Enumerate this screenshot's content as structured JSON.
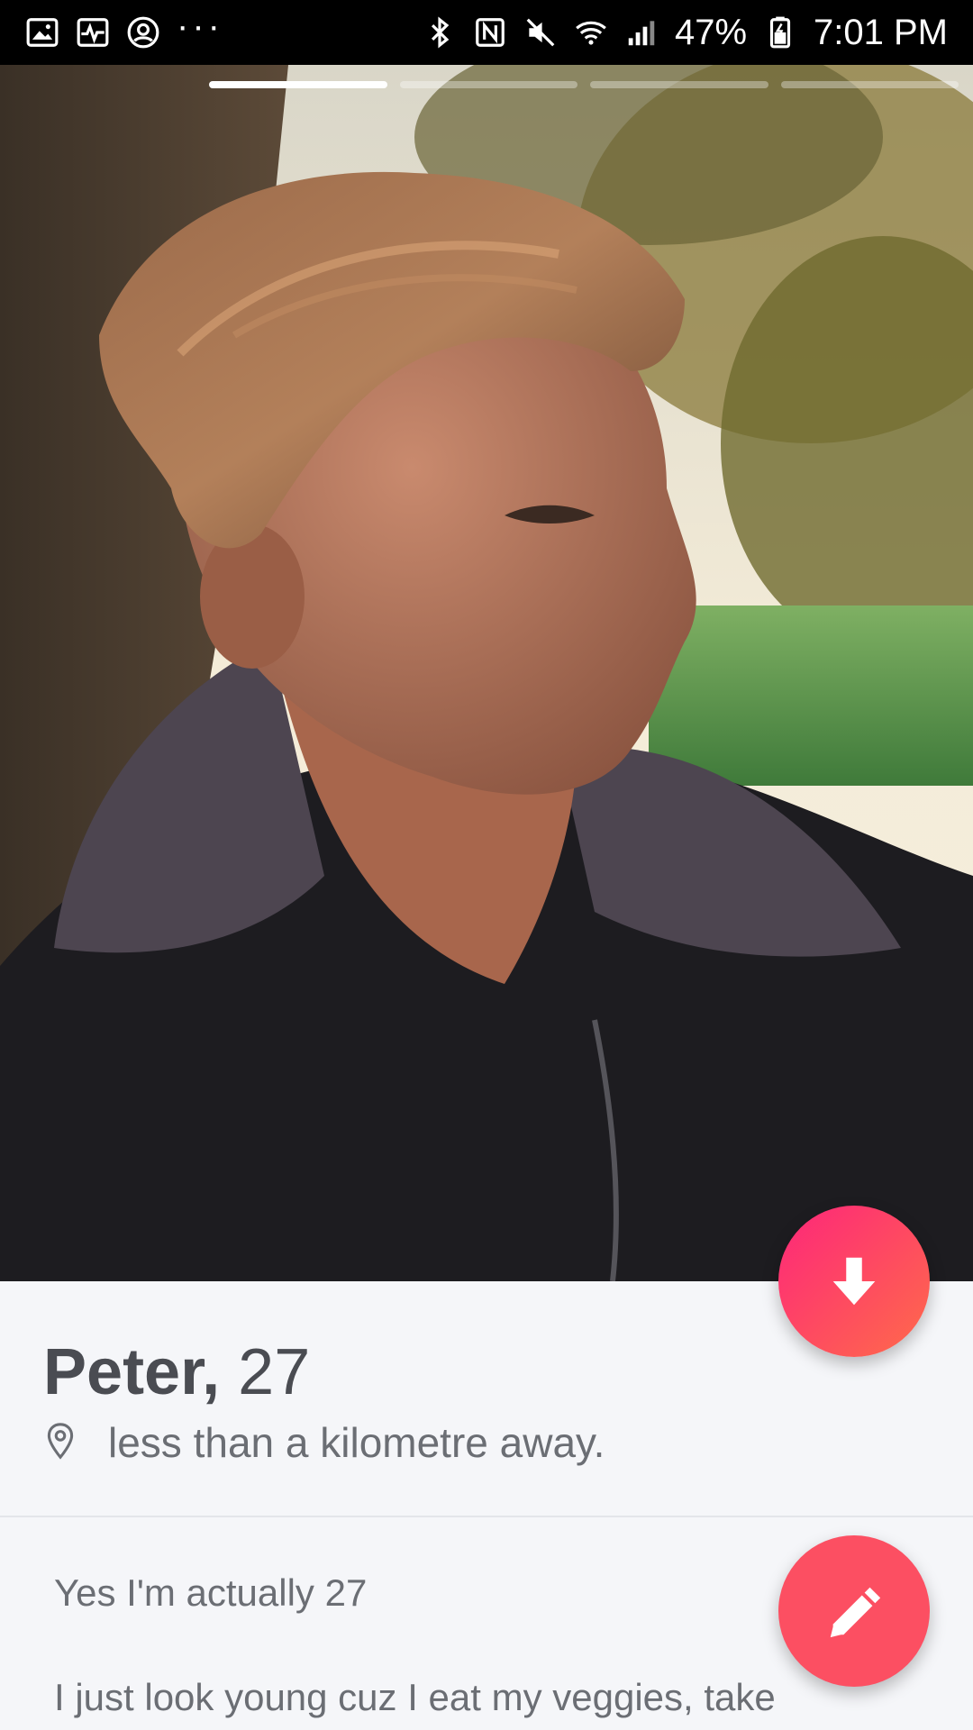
{
  "status_bar": {
    "left_icons": [
      "gallery-icon",
      "activity-icon",
      "account-icon",
      "more-dots-icon"
    ],
    "more_dots": "···",
    "right_icons": [
      "bluetooth-icon",
      "nfc-icon",
      "mute-icon",
      "wifi-icon",
      "signal-icon"
    ],
    "battery_percent": "47%",
    "time": "7:01 PM"
  },
  "photo": {
    "segments": 4,
    "active_segment": 1
  },
  "profile": {
    "name": "Peter,",
    "age": "27",
    "distance": "less than a kilometre away."
  },
  "bio": {
    "line1": "Yes I'm actually 27",
    "line2": "I just look young cuz I eat my veggies, take"
  },
  "colors": {
    "accent_gradient_start": "#fd267a",
    "accent_gradient_end": "#ff6b4a",
    "edit_button": "#fc4f62",
    "text_primary": "#4a4c52",
    "text_secondary": "#6b6e74"
  },
  "buttons": {
    "collapse_icon": "arrow-down-icon",
    "edit_icon": "pencil-icon"
  }
}
